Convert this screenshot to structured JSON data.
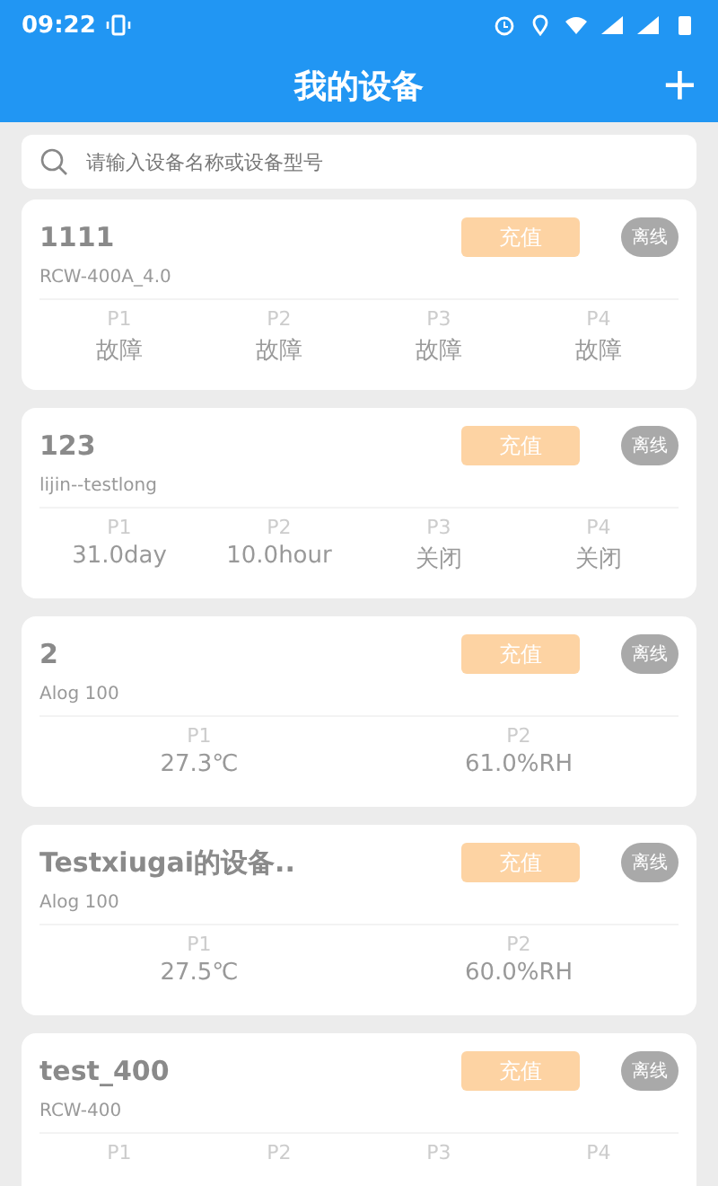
{
  "status_bar": {
    "time": "09:22"
  },
  "header": {
    "title": "我的设备",
    "add_label": "+"
  },
  "search": {
    "placeholder": "请输入设备名称或设备型号"
  },
  "devices": [
    {
      "name": "1111",
      "model": "RCW-400A_4.0",
      "recharge": "充值",
      "status": "离线",
      "params": [
        {
          "label": "P1",
          "value": "故障"
        },
        {
          "label": "P2",
          "value": "故障"
        },
        {
          "label": "P3",
          "value": "故障"
        },
        {
          "label": "P4",
          "value": "故障"
        }
      ]
    },
    {
      "name": "123",
      "model": "lijin--testlong",
      "recharge": "充值",
      "status": "离线",
      "params": [
        {
          "label": "P1",
          "value": "31.0day"
        },
        {
          "label": "P2",
          "value": "10.0hour"
        },
        {
          "label": "P3",
          "value": "关闭"
        },
        {
          "label": "P4",
          "value": "关闭"
        }
      ]
    },
    {
      "name": "2",
      "model": "Alog 100",
      "recharge": "充值",
      "status": "离线",
      "params": [
        {
          "label": "P1",
          "value": "27.3℃"
        },
        {
          "label": "P2",
          "value": "61.0%RH"
        }
      ]
    },
    {
      "name": "Testxiugai的设备..",
      "model": "Alog 100",
      "recharge": "充值",
      "status": "离线",
      "params": [
        {
          "label": "P1",
          "value": "27.5℃"
        },
        {
          "label": "P2",
          "value": "60.0%RH"
        }
      ]
    },
    {
      "name": "test_400",
      "model": "RCW-400",
      "recharge": "充值",
      "status": "离线",
      "params": [
        {
          "label": "P1"
        },
        {
          "label": "P2"
        },
        {
          "label": "P3"
        },
        {
          "label": "P4"
        }
      ]
    }
  ]
}
